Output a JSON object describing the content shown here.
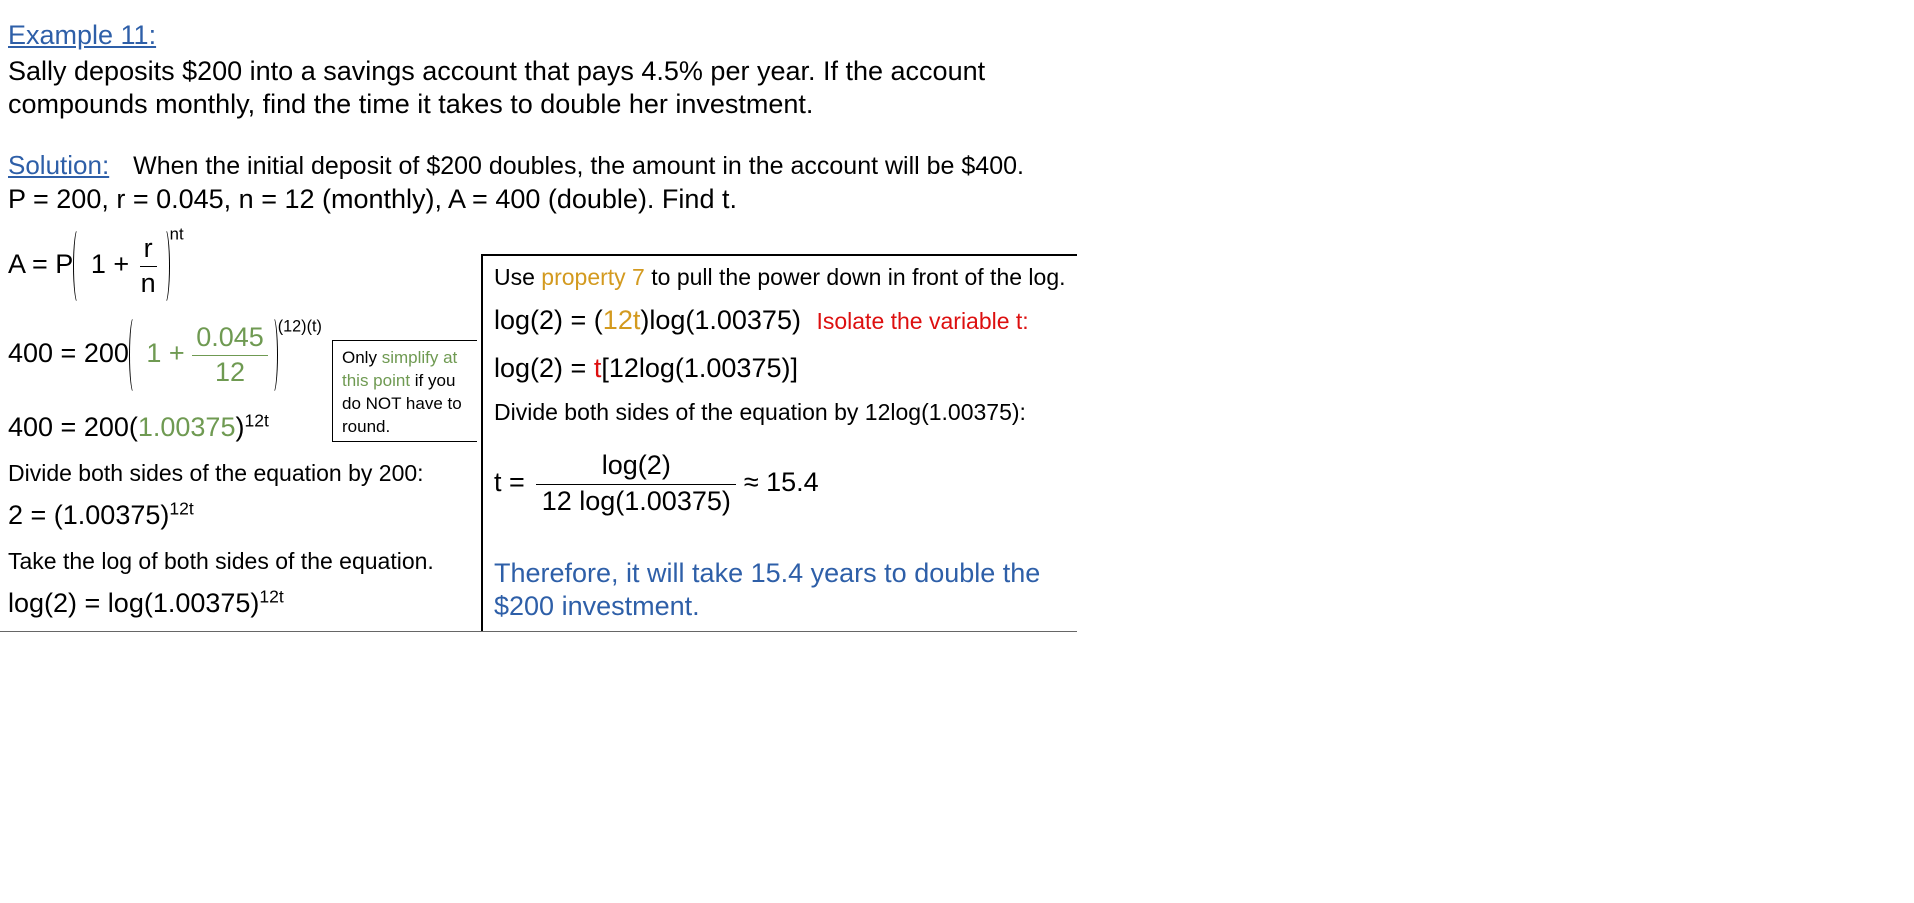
{
  "example": {
    "heading": "Example 11:",
    "problem_line1": "Sally deposits $200 into a savings account that pays 4.5% per year.  If the account",
    "problem_line2": "compounds monthly, find the time it takes to double her investment."
  },
  "solution": {
    "label": "Solution:",
    "intro": "When the initial deposit of $200 doubles, the amount in the account will be $400.",
    "givens": "P = 200,  r = 0.045,  n = 12 (monthly),  A = 400 (double).  Find t."
  },
  "left": {
    "formula": {
      "lhs": "A = P",
      "one_plus": "1 +",
      "num": "r",
      "den": "n",
      "exp": "nt"
    },
    "sub": {
      "lhs": "400 = 200",
      "one_plus": "1 +",
      "num": "0.045",
      "den": "12",
      "exp": "(12)(t)"
    },
    "step3": {
      "lhs": "400 = 200(",
      "base": "1.00375",
      "rhs": ")",
      "exp": "12t"
    },
    "divide_200": "Divide both sides of the equation by 200:",
    "step4": {
      "text": "2 = (1.00375)",
      "exp": "12t"
    },
    "take_log": "Take the log of both sides of the equation.",
    "step5": {
      "text": "log(2) = log(1.00375)",
      "exp": "12t"
    }
  },
  "note": {
    "part1": "Only ",
    "part2": "simplify at this point",
    "part3": " if you do NOT have to round."
  },
  "right": {
    "property": {
      "pre": "Use ",
      "link": "property 7",
      "post": " to pull the power down in front of the log."
    },
    "log_line1": {
      "pre": "log(2) = (",
      "mid": "12t",
      "post": ")log(1.00375)",
      "hint": "Isolate the variable t:"
    },
    "log_line2": {
      "pre": "log(2) = ",
      "mid": "t",
      "post": "[12log(1.00375)]"
    },
    "divide": "Divide both sides of the equation by 12log(1.00375):",
    "t_eq": {
      "lhs": "t =",
      "num": "log(2)",
      "den": "12 log(1.00375)",
      "approx": "≈ 15.4"
    },
    "conclusion_line1": "Therefore, it will take 15.4 years to double the",
    "conclusion_line2": "$200 investment."
  },
  "colors": {
    "blue": "#2e5fa8",
    "green": "#6f9a52",
    "orange": "#d39a1f",
    "red": "#dd0f0f"
  }
}
